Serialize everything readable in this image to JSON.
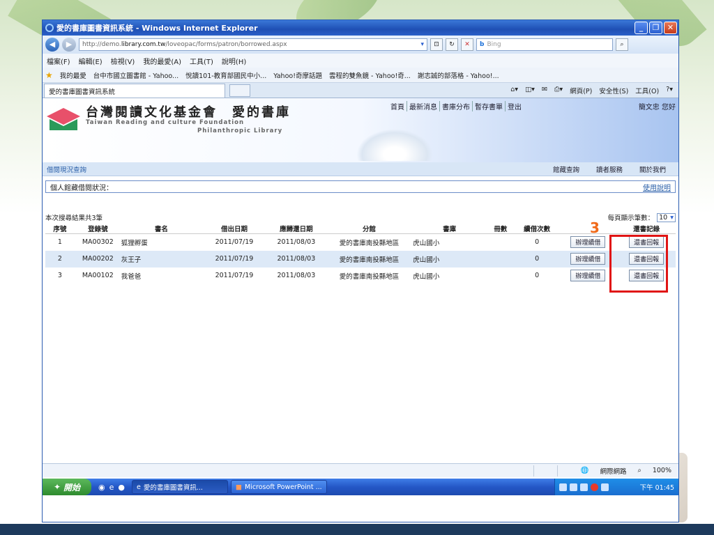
{
  "window": {
    "title": "愛的書庫圖書資訊系統 - Windows Internet Explorer"
  },
  "address": {
    "url_prefix": "http://demo.",
    "url_domain": "library.com.tw",
    "url_path": "/loveopac/forms/patron/borrowed.aspx",
    "search_placeholder": "Bing"
  },
  "menu": [
    "檔案(F)",
    "編輯(E)",
    "檢視(V)",
    "我的最愛(A)",
    "工具(T)",
    "說明(H)"
  ],
  "favorites": {
    "label": "我的最愛",
    "items": [
      "台中市國立圖書館 - Yahoo...",
      "悅讀101-教育部國民中小...",
      "Yahoo!奇摩話題",
      "雲程的雙魚鏡 - Yahoo!奇...",
      "謝志誠的部落格 - Yahoo!..."
    ]
  },
  "tab": {
    "label": "愛的書庫圖書資訊系統"
  },
  "commands": [
    "網頁(P)",
    "安全性(S)",
    "工具(O)"
  ],
  "site": {
    "org_cn": "台灣閱讀文化基金會　愛的書庫",
    "org_en1": "Taiwan Reading and culture Foundation",
    "org_en2": "Philanthropic Library",
    "nav": [
      "首頁",
      "最新消息",
      "書庫分布",
      "暫存書單",
      "登出"
    ],
    "user": "簡文忠 您好",
    "crumb": "借閱現況查詢",
    "sub_links": [
      "館藏查詢",
      "讀者服務",
      "關於我們"
    ]
  },
  "status_box": {
    "label": "個人館藏借閱狀況：",
    "help": "使用說明"
  },
  "results": {
    "summary": "本次搜尋結果共3筆",
    "per_page_label": "每頁顯示筆數：",
    "per_page_value": "10"
  },
  "table": {
    "headers": [
      "序號",
      "登錄號",
      "書名",
      "借出日期",
      "應歸還日期",
      "分館",
      "書庫",
      "冊數",
      "續借次數",
      "",
      "還書記錄"
    ],
    "rows": [
      {
        "no": "1",
        "acc": "MA00302",
        "title": "狐狸孵蛋",
        "out": "2011/07/19",
        "due": "2011/08/03",
        "branch": "愛的書庫南投縣地區",
        "lib": "虎山國小",
        "qty": "",
        "renew": "0",
        "renew_btn": "辦理續借",
        "return_btn": "還書回報"
      },
      {
        "no": "2",
        "acc": "MA00202",
        "title": "灰王子",
        "out": "2011/07/19",
        "due": "2011/08/03",
        "branch": "愛的書庫南投縣地區",
        "lib": "虎山國小",
        "qty": "",
        "renew": "0",
        "renew_btn": "辦理續借",
        "return_btn": "還書回報"
      },
      {
        "no": "3",
        "acc": "MA00102",
        "title": "我爸爸",
        "out": "2011/07/19",
        "due": "2011/08/03",
        "branch": "愛的書庫南投縣地區",
        "lib": "虎山國小",
        "qty": "",
        "renew": "0",
        "renew_btn": "辦理續借",
        "return_btn": "還書回報"
      }
    ]
  },
  "annotation": {
    "step": "3"
  },
  "statusbar": {
    "zone": "網際網路",
    "zoom": "100%"
  },
  "taskbar": {
    "start": "開始",
    "tasks": [
      "愛的書庫圖書資訊...",
      "Microsoft PowerPoint ..."
    ],
    "clock": "下午 01:45"
  },
  "colors": {
    "highlight": "#e01414",
    "step": "#f06a1a",
    "title_bar": "#1f4fb4"
  }
}
